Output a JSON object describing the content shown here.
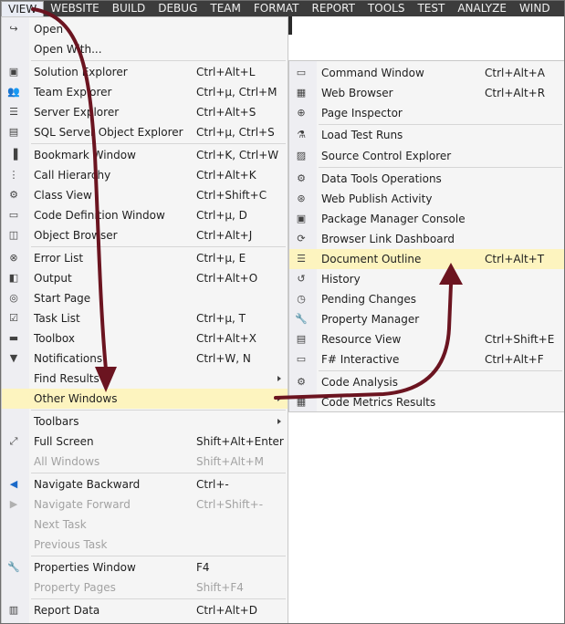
{
  "menubar": [
    "VIEW",
    "WEBSITE",
    "BUILD",
    "DEBUG",
    "TEAM",
    "FORMAT",
    "REPORT",
    "TOOLS",
    "TEST",
    "ANALYZE",
    "WIND"
  ],
  "view_menu": [
    {
      "label": "Open",
      "shortcut": "",
      "icon": "open-icon",
      "glyph": "↪"
    },
    {
      "label": "Open With...",
      "shortcut": "",
      "icon": "",
      "glyph": ""
    },
    {
      "label": "Solution Explorer",
      "shortcut": "Ctrl+Alt+L",
      "icon": "solution-explorer-icon",
      "glyph": "▣"
    },
    {
      "label": "Team Explorer",
      "shortcut": "Ctrl+µ, Ctrl+M",
      "icon": "team-explorer-icon",
      "glyph": "👥"
    },
    {
      "label": "Server Explorer",
      "shortcut": "Ctrl+Alt+S",
      "icon": "server-explorer-icon",
      "glyph": "☰"
    },
    {
      "label": "SQL Server Object Explorer",
      "shortcut": "Ctrl+µ, Ctrl+S",
      "icon": "sql-server-icon",
      "glyph": "▤"
    },
    {
      "label": "Bookmark Window",
      "shortcut": "Ctrl+K, Ctrl+W",
      "icon": "bookmark-icon",
      "glyph": "▐"
    },
    {
      "label": "Call Hierarchy",
      "shortcut": "Ctrl+Alt+K",
      "icon": "call-hierarchy-icon",
      "glyph": "⋮"
    },
    {
      "label": "Class View",
      "shortcut": "Ctrl+Shift+C",
      "icon": "class-view-icon",
      "glyph": "⚙"
    },
    {
      "label": "Code Definition Window",
      "shortcut": "Ctrl+µ, D",
      "icon": "code-definition-icon",
      "glyph": "▭"
    },
    {
      "label": "Object Browser",
      "shortcut": "Ctrl+Alt+J",
      "icon": "object-browser-icon",
      "glyph": "◫"
    },
    {
      "label": "Error List",
      "shortcut": "Ctrl+µ, E",
      "icon": "error-list-icon",
      "glyph": "⊗"
    },
    {
      "label": "Output",
      "shortcut": "Ctrl+Alt+O",
      "icon": "output-icon",
      "glyph": "◧"
    },
    {
      "label": "Start Page",
      "shortcut": "",
      "icon": "start-page-icon",
      "glyph": "◎"
    },
    {
      "label": "Task List",
      "shortcut": "Ctrl+µ, T",
      "icon": "task-list-icon",
      "glyph": "☑"
    },
    {
      "label": "Toolbox",
      "shortcut": "Ctrl+Alt+X",
      "icon": "toolbox-icon",
      "glyph": "▬"
    },
    {
      "label": "Notifications",
      "shortcut": "Ctrl+W, N",
      "icon": "notifications-icon",
      "glyph": "▼"
    },
    {
      "label": "Find Results",
      "shortcut": "",
      "icon": "",
      "glyph": ""
    },
    {
      "label": "Other Windows",
      "shortcut": "",
      "icon": "",
      "glyph": ""
    },
    {
      "label": "Toolbars",
      "shortcut": "",
      "icon": "",
      "glyph": ""
    },
    {
      "label": "Full Screen",
      "shortcut": "Shift+Alt+Enter",
      "icon": "full-screen-icon",
      "glyph": "⤢"
    },
    {
      "label": "All Windows",
      "shortcut": "Shift+Alt+M",
      "icon": "",
      "glyph": ""
    },
    {
      "label": "Navigate Backward",
      "shortcut": "Ctrl+-",
      "icon": "navigate-backward-icon",
      "glyph": "◀"
    },
    {
      "label": "Navigate Forward",
      "shortcut": "Ctrl+Shift+-",
      "icon": "navigate-forward-icon",
      "glyph": "▶"
    },
    {
      "label": "Next Task",
      "shortcut": "",
      "icon": "",
      "glyph": ""
    },
    {
      "label": "Previous Task",
      "shortcut": "",
      "icon": "",
      "glyph": ""
    },
    {
      "label": "Properties Window",
      "shortcut": "F4",
      "icon": "properties-icon",
      "glyph": "🔧"
    },
    {
      "label": "Property Pages",
      "shortcut": "Shift+F4",
      "icon": "",
      "glyph": ""
    },
    {
      "label": "Report Data",
      "shortcut": "Ctrl+Alt+D",
      "icon": "report-data-icon",
      "glyph": "▥"
    }
  ],
  "other_windows_menu": [
    {
      "label": "Command Window",
      "shortcut": "Ctrl+Alt+A",
      "icon": "command-window-icon",
      "glyph": "▭"
    },
    {
      "label": "Web Browser",
      "shortcut": "Ctrl+Alt+R",
      "icon": "web-browser-icon",
      "glyph": "▦"
    },
    {
      "label": "Page Inspector",
      "shortcut": "",
      "icon": "page-inspector-icon",
      "glyph": "⊕"
    },
    {
      "label": "Load Test Runs",
      "shortcut": "",
      "icon": "load-test-icon",
      "glyph": "⚗"
    },
    {
      "label": "Source Control Explorer",
      "shortcut": "",
      "icon": "source-control-icon",
      "glyph": "▨"
    },
    {
      "label": "Data Tools Operations",
      "shortcut": "",
      "icon": "data-tools-icon",
      "glyph": "⚙"
    },
    {
      "label": "Web Publish Activity",
      "shortcut": "",
      "icon": "web-publish-icon",
      "glyph": "⊛"
    },
    {
      "label": "Package Manager Console",
      "shortcut": "",
      "icon": "package-manager-icon",
      "glyph": "▣"
    },
    {
      "label": "Browser Link Dashboard",
      "shortcut": "",
      "icon": "browser-link-icon",
      "glyph": "⟳"
    },
    {
      "label": "Document Outline",
      "shortcut": "Ctrl+Alt+T",
      "icon": "document-outline-icon",
      "glyph": "☰"
    },
    {
      "label": "History",
      "shortcut": "",
      "icon": "history-icon",
      "glyph": "↺"
    },
    {
      "label": "Pending Changes",
      "shortcut": "",
      "icon": "pending-changes-icon",
      "glyph": "◷"
    },
    {
      "label": "Property Manager",
      "shortcut": "",
      "icon": "property-manager-icon",
      "glyph": "🔧"
    },
    {
      "label": "Resource View",
      "shortcut": "Ctrl+Shift+E",
      "icon": "resource-view-icon",
      "glyph": "▤"
    },
    {
      "label": "F# Interactive",
      "shortcut": "Ctrl+Alt+F",
      "icon": "fsharp-interactive-icon",
      "glyph": "▭"
    },
    {
      "label": "Code Analysis",
      "shortcut": "",
      "icon": "code-analysis-icon",
      "glyph": "⚙"
    },
    {
      "label": "Code Metrics Results",
      "shortcut": "",
      "icon": "code-metrics-icon",
      "glyph": "▦"
    }
  ],
  "colors": {
    "menubar": "#3c3c3c",
    "menu_bg": "#f5f5f5",
    "highlight": "#fdf4bf",
    "annotation_arrow": "#6b1420"
  }
}
